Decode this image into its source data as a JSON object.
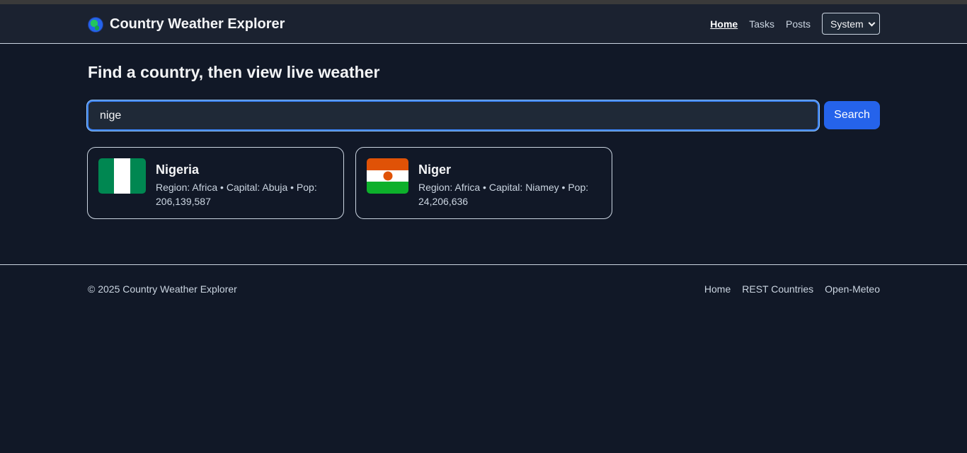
{
  "header": {
    "title": "Country Weather Explorer",
    "nav": {
      "home": "Home",
      "tasks": "Tasks",
      "posts": "Posts"
    },
    "theme_select": "System"
  },
  "main": {
    "heading": "Find a country, then view live weather",
    "search": {
      "value": "nige",
      "button": "Search"
    },
    "results": [
      {
        "name": "Nigeria",
        "meta": "Region: Africa • Capital: Abuja • Pop: 206,139,587",
        "flag_colors": [
          "#008751",
          "#ffffff",
          "#008751"
        ]
      },
      {
        "name": "Niger",
        "meta": "Region: Africa • Capital: Niamey • Pop: 24,206,636",
        "flag_colors": [
          "#e05206",
          "#ffffff",
          "#0db02b"
        ]
      }
    ]
  },
  "footer": {
    "copyright": "© 2025 Country Weather Explorer",
    "links": [
      "Home",
      "REST Countries",
      "Open-Meteo"
    ]
  },
  "colors": {
    "accent": "#2563eb",
    "background": "#111827",
    "header_bg": "#1b2230"
  }
}
